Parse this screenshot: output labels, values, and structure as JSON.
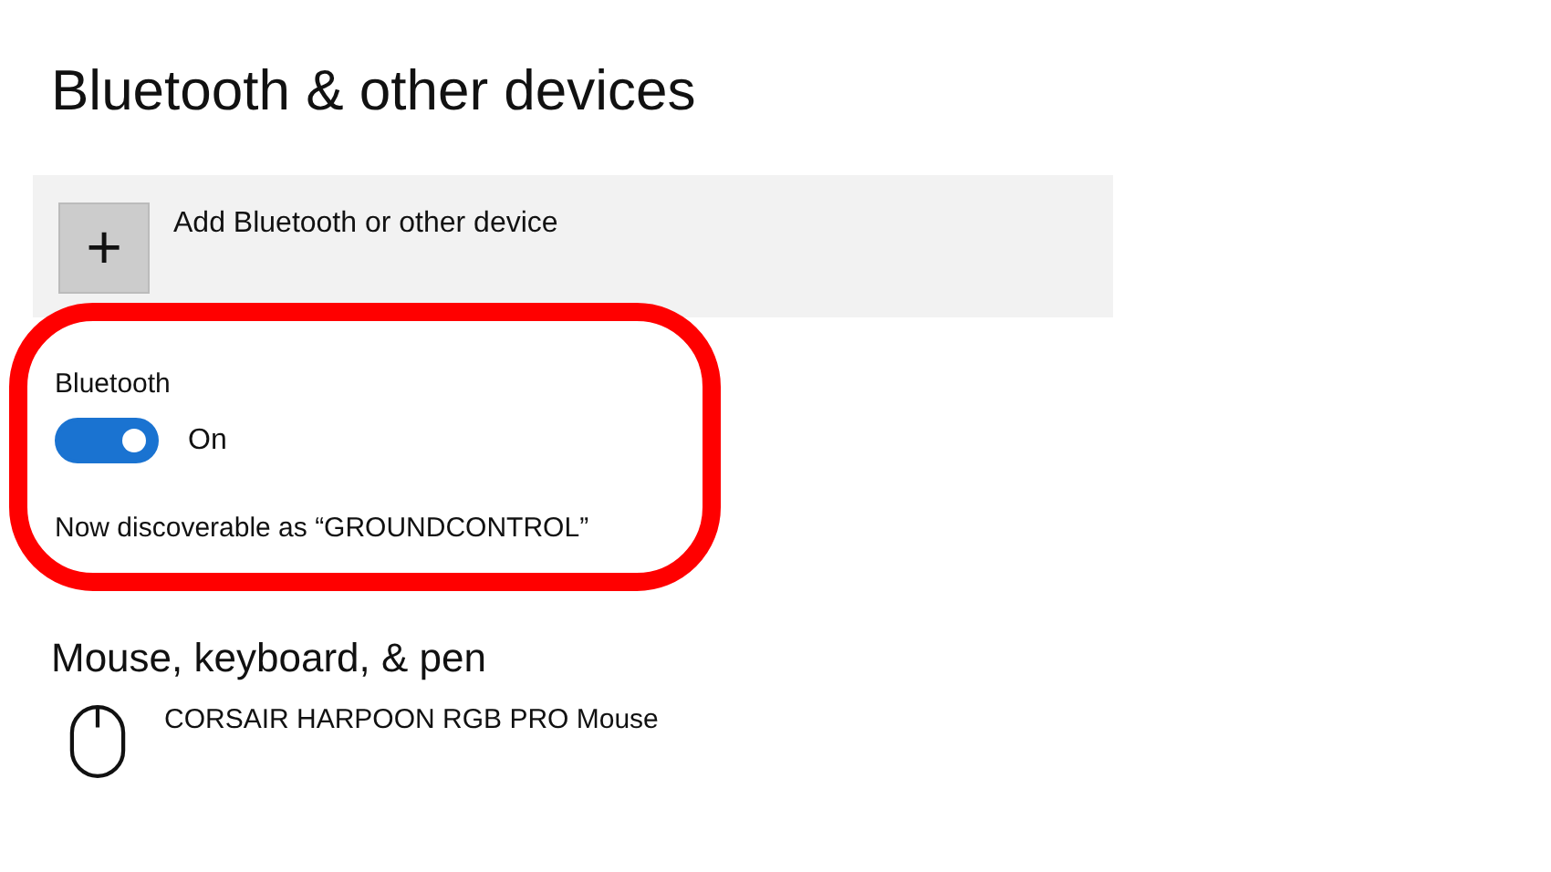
{
  "page_title": "Bluetooth & other devices",
  "add_device": {
    "label": "Add Bluetooth or other device",
    "icon": "+"
  },
  "bluetooth": {
    "label": "Bluetooth",
    "on": true,
    "state_text": "On",
    "discoverable_text": "Now discoverable as “GROUNDCONTROL”",
    "highlighted": true
  },
  "sections": [
    {
      "title": "Mouse, keyboard, & pen",
      "devices": [
        {
          "kind": "mouse",
          "name": "CORSAIR HARPOON RGB PRO Mouse"
        }
      ]
    }
  ]
}
